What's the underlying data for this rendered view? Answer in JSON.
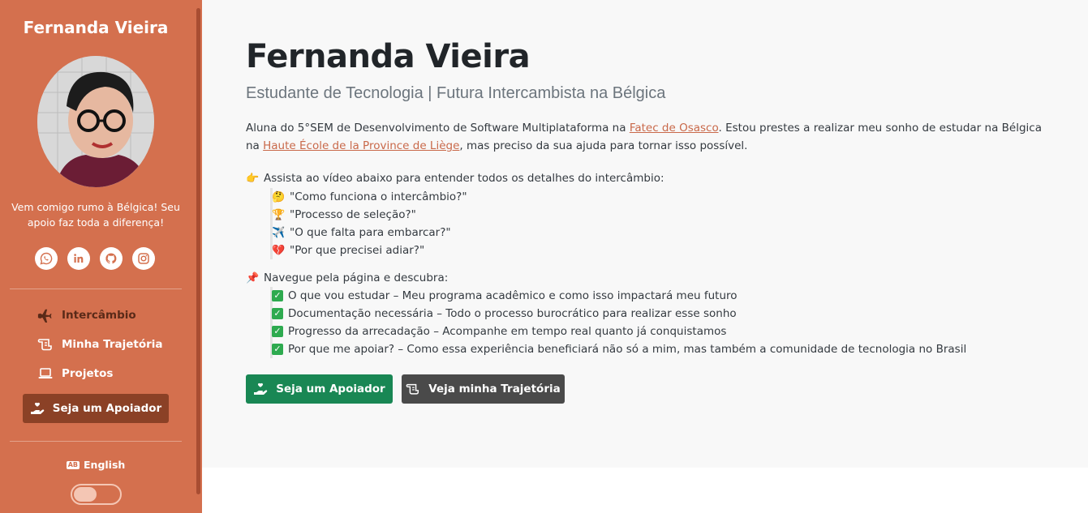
{
  "sidebar": {
    "name": "Fernanda Vieira",
    "tagline": "Vem comigo rumo à Bélgica! Seu apoio faz toda a diferença!",
    "socials": [
      {
        "icon": "whatsapp-icon"
      },
      {
        "icon": "linkedin-icon"
      },
      {
        "icon": "github-icon"
      },
      {
        "icon": "instagram-icon"
      }
    ],
    "nav": [
      {
        "label": "Intercâmbio",
        "icon": "plane-icon",
        "active": true
      },
      {
        "label": "Minha Trajetória",
        "icon": "scroll-icon",
        "active": false
      },
      {
        "label": "Projetos",
        "icon": "laptop-icon",
        "active": false
      }
    ],
    "cta_label": "Seja um Apoiador",
    "language_label": "English",
    "language_icon_text": "AB"
  },
  "main": {
    "title": "Fernanda Vieira",
    "subtitle": "Estudante de Tecnologia | Futura Intercambista na Bélgica",
    "intro": {
      "part1": "Aluna do 5°SEM de Desenvolvimento de Software Multiplataforma na ",
      "link1": "Fatec de Osasco",
      "part2": ". Estou prestes a realizar meu sonho de estudar na Bélgica na ",
      "link2": "Haute École de la Province de Liège",
      "part3": ", mas preciso da sua ajuda para tornar isso possível."
    },
    "video_section": {
      "emoji": "👉",
      "title": "Assista ao vídeo abaixo para entender todos os detalhes do intercâmbio:",
      "items": [
        {
          "emoji": "🤔",
          "text": "\"Como funciona o intercâmbio?\""
        },
        {
          "emoji": "🏆",
          "text": "\"Processo de seleção?\""
        },
        {
          "emoji": "✈️",
          "text": "\"O que falta para embarcar?\""
        },
        {
          "emoji": "💔",
          "text": "\"Por que precisei adiar?\""
        }
      ]
    },
    "navigate_section": {
      "emoji": "📌",
      "title": "Navegue pela página e descubra:",
      "items": [
        "O que vou estudar – Meu programa acadêmico e como isso impactará meu futuro",
        "Documentação necessária – Todo o processo burocrático para realizar esse sonho",
        "Progresso da arrecadação – Acompanhe em tempo real quanto já conquistamos",
        "Por que me apoiar? – Como essa experiência beneficiará não só a mim, mas também a comunidade de tecnologia no Brasil"
      ]
    },
    "buttons": {
      "support": "Seja um Apoiador",
      "trajectory": "Veja minha Trajetória"
    }
  },
  "colors": {
    "sidebar": "#d4704e",
    "active_nav": "#5a2a18",
    "cta_sidebar": "#8b4126",
    "green": "#198754",
    "dark": "#4a4a4a",
    "link": "#c9694a"
  }
}
